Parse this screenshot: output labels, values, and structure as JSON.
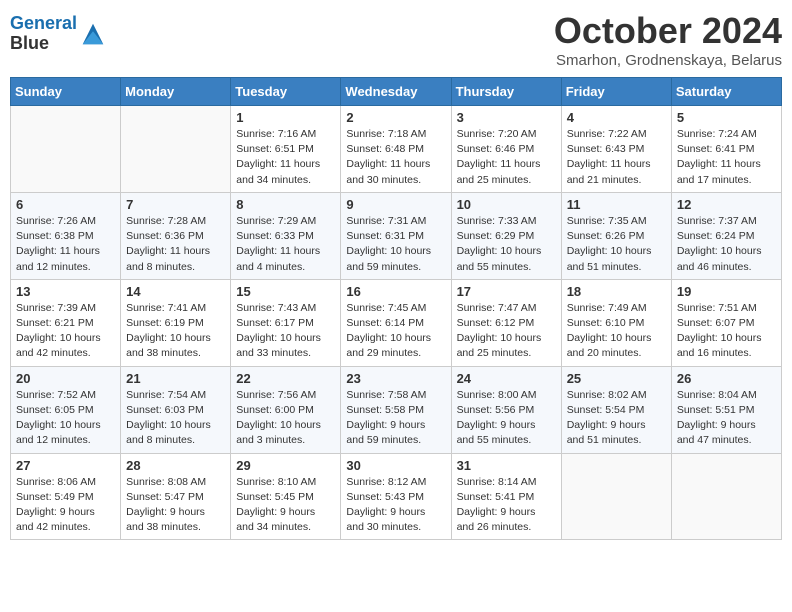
{
  "header": {
    "logo_line1": "General",
    "logo_line2": "Blue",
    "title": "October 2024",
    "location": "Smarhon, Grodnenskaya, Belarus"
  },
  "days_of_week": [
    "Sunday",
    "Monday",
    "Tuesday",
    "Wednesday",
    "Thursday",
    "Friday",
    "Saturday"
  ],
  "weeks": [
    [
      {
        "day": "",
        "content": ""
      },
      {
        "day": "",
        "content": ""
      },
      {
        "day": "1",
        "content": "Sunrise: 7:16 AM\nSunset: 6:51 PM\nDaylight: 11 hours\nand 34 minutes."
      },
      {
        "day": "2",
        "content": "Sunrise: 7:18 AM\nSunset: 6:48 PM\nDaylight: 11 hours\nand 30 minutes."
      },
      {
        "day": "3",
        "content": "Sunrise: 7:20 AM\nSunset: 6:46 PM\nDaylight: 11 hours\nand 25 minutes."
      },
      {
        "day": "4",
        "content": "Sunrise: 7:22 AM\nSunset: 6:43 PM\nDaylight: 11 hours\nand 21 minutes."
      },
      {
        "day": "5",
        "content": "Sunrise: 7:24 AM\nSunset: 6:41 PM\nDaylight: 11 hours\nand 17 minutes."
      }
    ],
    [
      {
        "day": "6",
        "content": "Sunrise: 7:26 AM\nSunset: 6:38 PM\nDaylight: 11 hours\nand 12 minutes."
      },
      {
        "day": "7",
        "content": "Sunrise: 7:28 AM\nSunset: 6:36 PM\nDaylight: 11 hours\nand 8 minutes."
      },
      {
        "day": "8",
        "content": "Sunrise: 7:29 AM\nSunset: 6:33 PM\nDaylight: 11 hours\nand 4 minutes."
      },
      {
        "day": "9",
        "content": "Sunrise: 7:31 AM\nSunset: 6:31 PM\nDaylight: 10 hours\nand 59 minutes."
      },
      {
        "day": "10",
        "content": "Sunrise: 7:33 AM\nSunset: 6:29 PM\nDaylight: 10 hours\nand 55 minutes."
      },
      {
        "day": "11",
        "content": "Sunrise: 7:35 AM\nSunset: 6:26 PM\nDaylight: 10 hours\nand 51 minutes."
      },
      {
        "day": "12",
        "content": "Sunrise: 7:37 AM\nSunset: 6:24 PM\nDaylight: 10 hours\nand 46 minutes."
      }
    ],
    [
      {
        "day": "13",
        "content": "Sunrise: 7:39 AM\nSunset: 6:21 PM\nDaylight: 10 hours\nand 42 minutes."
      },
      {
        "day": "14",
        "content": "Sunrise: 7:41 AM\nSunset: 6:19 PM\nDaylight: 10 hours\nand 38 minutes."
      },
      {
        "day": "15",
        "content": "Sunrise: 7:43 AM\nSunset: 6:17 PM\nDaylight: 10 hours\nand 33 minutes."
      },
      {
        "day": "16",
        "content": "Sunrise: 7:45 AM\nSunset: 6:14 PM\nDaylight: 10 hours\nand 29 minutes."
      },
      {
        "day": "17",
        "content": "Sunrise: 7:47 AM\nSunset: 6:12 PM\nDaylight: 10 hours\nand 25 minutes."
      },
      {
        "day": "18",
        "content": "Sunrise: 7:49 AM\nSunset: 6:10 PM\nDaylight: 10 hours\nand 20 minutes."
      },
      {
        "day": "19",
        "content": "Sunrise: 7:51 AM\nSunset: 6:07 PM\nDaylight: 10 hours\nand 16 minutes."
      }
    ],
    [
      {
        "day": "20",
        "content": "Sunrise: 7:52 AM\nSunset: 6:05 PM\nDaylight: 10 hours\nand 12 minutes."
      },
      {
        "day": "21",
        "content": "Sunrise: 7:54 AM\nSunset: 6:03 PM\nDaylight: 10 hours\nand 8 minutes."
      },
      {
        "day": "22",
        "content": "Sunrise: 7:56 AM\nSunset: 6:00 PM\nDaylight: 10 hours\nand 3 minutes."
      },
      {
        "day": "23",
        "content": "Sunrise: 7:58 AM\nSunset: 5:58 PM\nDaylight: 9 hours\nand 59 minutes."
      },
      {
        "day": "24",
        "content": "Sunrise: 8:00 AM\nSunset: 5:56 PM\nDaylight: 9 hours\nand 55 minutes."
      },
      {
        "day": "25",
        "content": "Sunrise: 8:02 AM\nSunset: 5:54 PM\nDaylight: 9 hours\nand 51 minutes."
      },
      {
        "day": "26",
        "content": "Sunrise: 8:04 AM\nSunset: 5:51 PM\nDaylight: 9 hours\nand 47 minutes."
      }
    ],
    [
      {
        "day": "27",
        "content": "Sunrise: 8:06 AM\nSunset: 5:49 PM\nDaylight: 9 hours\nand 42 minutes."
      },
      {
        "day": "28",
        "content": "Sunrise: 8:08 AM\nSunset: 5:47 PM\nDaylight: 9 hours\nand 38 minutes."
      },
      {
        "day": "29",
        "content": "Sunrise: 8:10 AM\nSunset: 5:45 PM\nDaylight: 9 hours\nand 34 minutes."
      },
      {
        "day": "30",
        "content": "Sunrise: 8:12 AM\nSunset: 5:43 PM\nDaylight: 9 hours\nand 30 minutes."
      },
      {
        "day": "31",
        "content": "Sunrise: 8:14 AM\nSunset: 5:41 PM\nDaylight: 9 hours\nand 26 minutes."
      },
      {
        "day": "",
        "content": ""
      },
      {
        "day": "",
        "content": ""
      }
    ]
  ]
}
